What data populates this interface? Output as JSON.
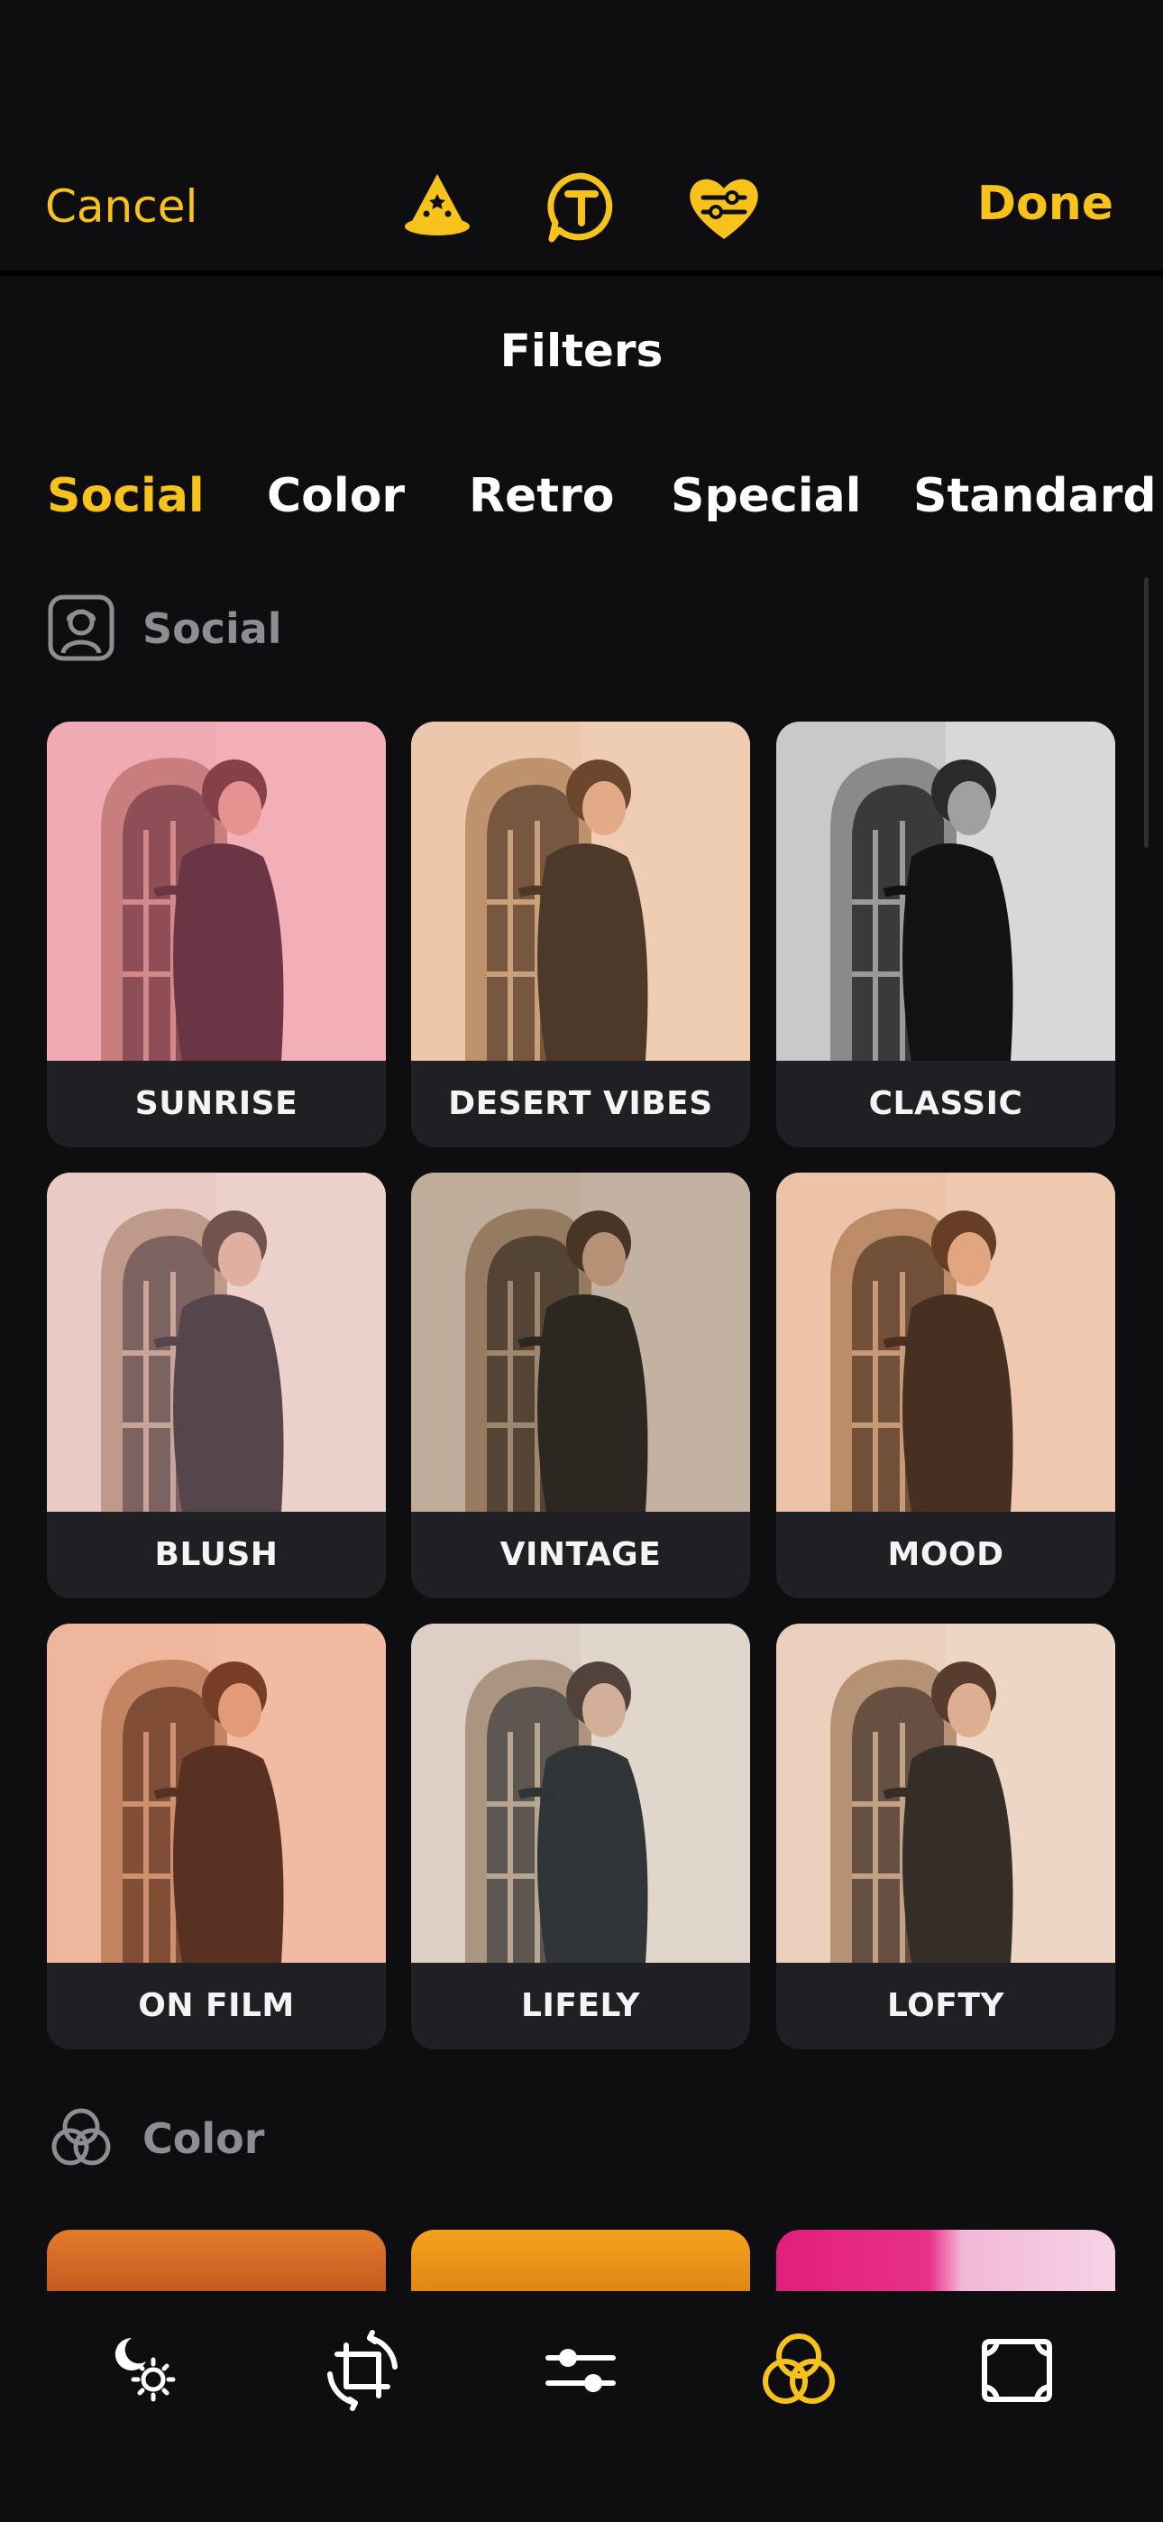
{
  "topbar": {
    "cancel_label": "Cancel",
    "done_label": "Done",
    "icons": [
      "magic-hat-icon",
      "text-bubble-icon",
      "heart-sliders-icon"
    ],
    "accent_color": "#f7c21a"
  },
  "title": "Filters",
  "tabs": [
    {
      "label": "Social",
      "active": true
    },
    {
      "label": "Color",
      "active": false
    },
    {
      "label": "Retro",
      "active": false
    },
    {
      "label": "Special",
      "active": false
    },
    {
      "label": "Standard",
      "active": false
    }
  ],
  "sections": [
    {
      "label": "Social",
      "icon": "portrait-sparkle-icon",
      "filters": [
        "SUNRISE",
        "DESERT VIBES",
        "CLASSIC",
        "BLUSH",
        "VINTAGE",
        "MOOD",
        "ON FILM",
        "LIFELY",
        "LOFTY"
      ]
    },
    {
      "label": "Color",
      "icon": "color-circles-icon"
    }
  ],
  "bottombar": {
    "icons": [
      "night-light-icon",
      "crop-rotate-icon",
      "adjust-sliders-icon",
      "filters-circles-icon",
      "frame-icon"
    ],
    "active": "filters-circles-icon"
  }
}
